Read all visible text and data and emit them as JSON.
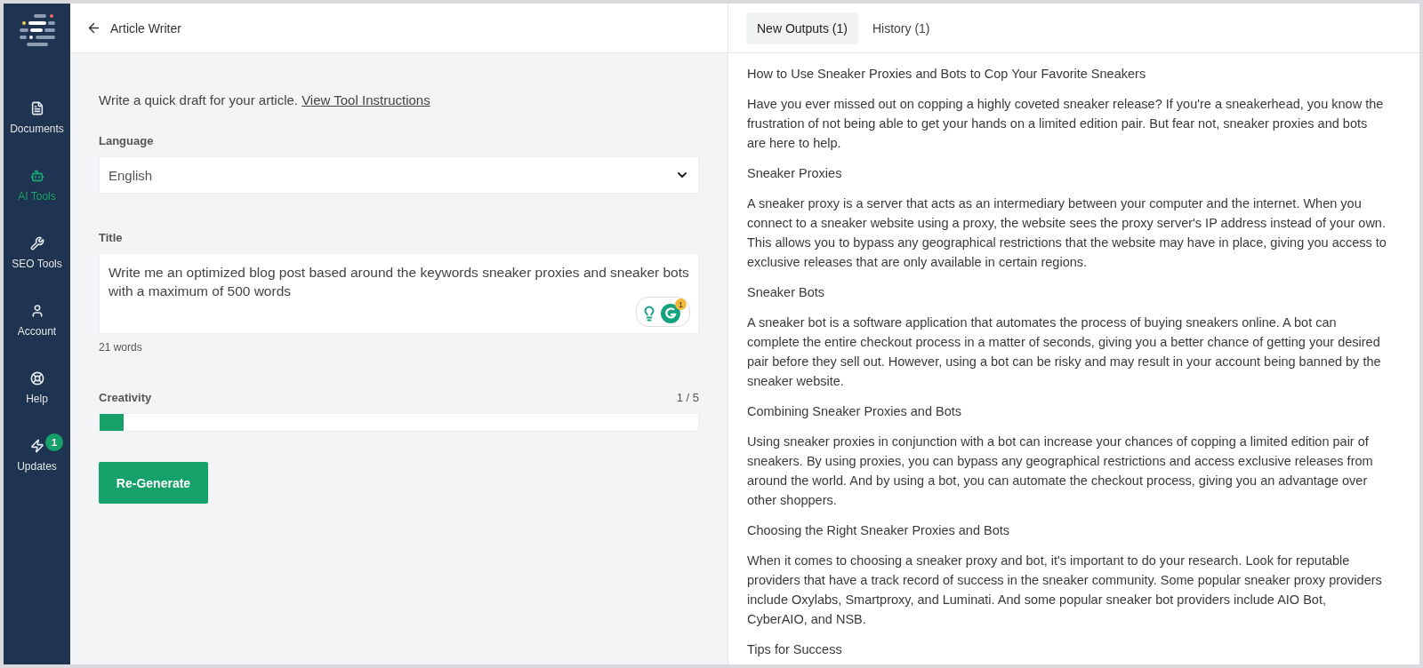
{
  "sidebar": {
    "items": [
      {
        "kind": "documents",
        "label": "Documents",
        "selected": false
      },
      {
        "kind": "ai",
        "label": "AI Tools",
        "selected": true
      },
      {
        "kind": "seo",
        "label": "SEO Tools",
        "selected": false
      },
      {
        "kind": "account",
        "label": "Account",
        "selected": false
      },
      {
        "kind": "help",
        "label": "Help",
        "selected": false
      },
      {
        "kind": "updates",
        "label": "Updates",
        "selected": false,
        "badge": "1"
      }
    ]
  },
  "header": {
    "title": "Article Writer"
  },
  "form": {
    "intro": "Write a quick draft for your article.",
    "intro_link": "View Tool Instructions",
    "language": {
      "label": "Language",
      "value": "English"
    },
    "title": {
      "label": "Title",
      "value": "Write me an optimized blog post based around the keywords sneaker proxies and sneaker bots with a maximum of 500 words",
      "word_count": "21 words",
      "grammarly_badge": "1"
    },
    "creativity": {
      "label": "Creativity",
      "reading": "1 / 5",
      "level": 0.04
    },
    "button": "Re-Generate"
  },
  "output_tabs": [
    {
      "label": "New Outputs (1)",
      "selected": true
    },
    {
      "label": "History (1)",
      "selected": false
    }
  ],
  "output": [
    "How to Use Sneaker Proxies and Bots to Cop Your Favorite Sneakers",
    "Have you ever missed out on copping a highly coveted sneaker release? If you're a sneakerhead, you know the frustration of not being able to get your hands on a limited edition pair. But fear not, sneaker proxies and bots are here to help.",
    "Sneaker Proxies",
    "A sneaker proxy is a server that acts as an intermediary between your computer and the internet. When you connect to a sneaker website using a proxy, the website sees the proxy server's IP address instead of your own. This allows you to bypass any geographical restrictions that the website may have in place, giving you access to exclusive releases that are only available in certain regions.",
    "Sneaker Bots",
    "A sneaker bot is a software application that automates the process of buying sneakers online. A bot can complete the entire checkout process in a matter of seconds, giving you a better chance of getting your desired pair before they sell out. However, using a bot can be risky and may result in your account being banned by the sneaker website.",
    "Combining Sneaker Proxies and Bots",
    "Using sneaker proxies in conjunction with a bot can increase your chances of copping a limited edition pair of sneakers. By using proxies, you can bypass any geographical restrictions and access exclusive releases from around the world. And by using a bot, you can automate the checkout process, giving you an advantage over other shoppers.",
    "Choosing the Right Sneaker Proxies and Bots",
    "When it comes to choosing a sneaker proxy and bot, it's important to do your research. Look for reputable providers that have a track record of success in the sneaker community. Some popular sneaker proxy providers include Oxylabs, Smartproxy, and Luminati. And some popular sneaker bot providers include AIO Bot, CyberAIO, and NSB.",
    "Tips for Success"
  ]
}
